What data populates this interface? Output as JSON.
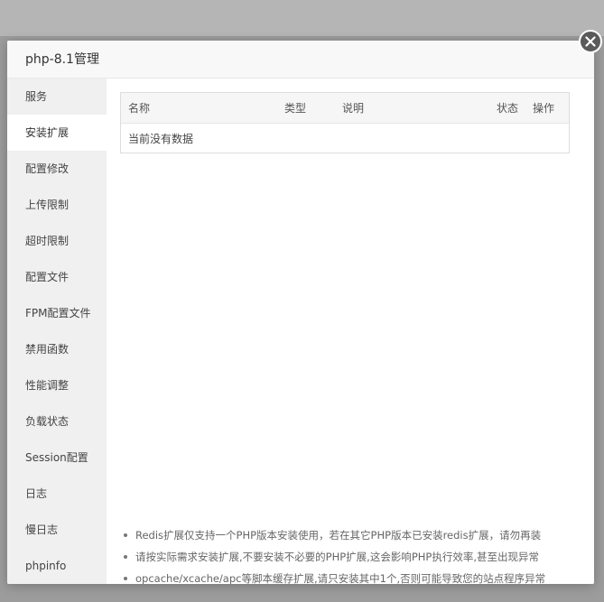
{
  "modal": {
    "title": "php-8.1管理",
    "close_icon": "close-icon"
  },
  "sidebar": {
    "items": [
      {
        "label": "服务",
        "active": false
      },
      {
        "label": "安装扩展",
        "active": true
      },
      {
        "label": "配置修改",
        "active": false
      },
      {
        "label": "上传限制",
        "active": false
      },
      {
        "label": "超时限制",
        "active": false
      },
      {
        "label": "配置文件",
        "active": false
      },
      {
        "label": "FPM配置文件",
        "active": false
      },
      {
        "label": "禁用函数",
        "active": false
      },
      {
        "label": "性能调整",
        "active": false
      },
      {
        "label": "负载状态",
        "active": false
      },
      {
        "label": "Session配置",
        "active": false
      },
      {
        "label": "日志",
        "active": false
      },
      {
        "label": "慢日志",
        "active": false
      },
      {
        "label": "phpinfo",
        "active": false
      }
    ]
  },
  "table": {
    "columns": [
      "名称",
      "类型",
      "说明",
      "状态",
      "操作"
    ],
    "empty_text": "当前没有数据"
  },
  "notes": [
    "Redis扩展仅支持一个PHP版本安装使用，若在其它PHP版本已安装redis扩展，请勿再装",
    "请按实际需求安装扩展,不要安装不必要的PHP扩展,这会影响PHP执行效率,甚至出现异常",
    "opcache/xcache/apc等脚本缓存扩展,请只安装其中1个,否则可能导致您的站点程序异常"
  ],
  "colors": {
    "overlay": "#9c9c9c",
    "sidebar_bg": "#f0f0f0",
    "close_button": "#5a5a5a"
  }
}
